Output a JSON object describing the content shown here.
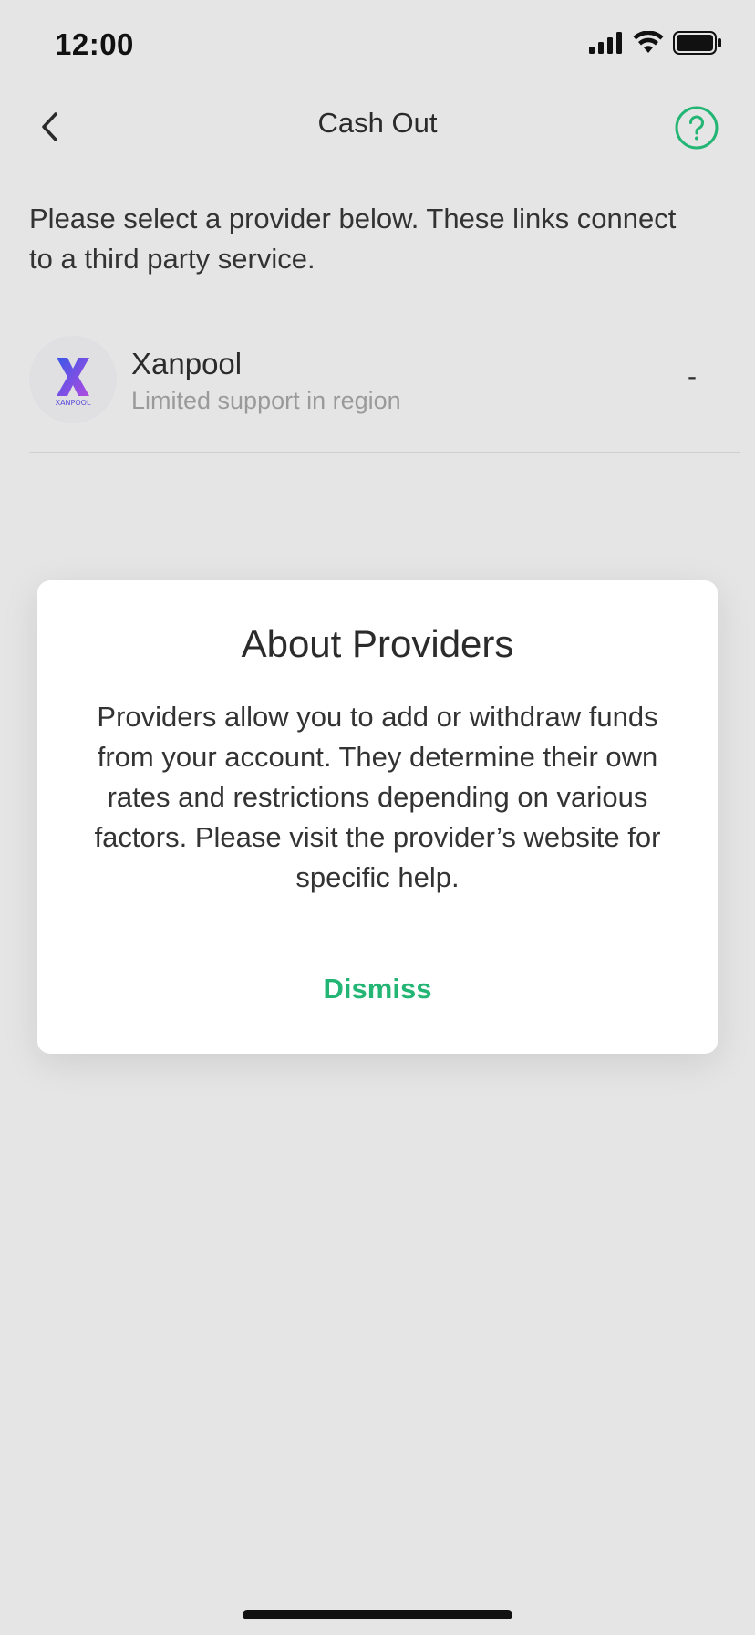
{
  "status_bar": {
    "time": "12:00"
  },
  "nav": {
    "title": "Cash Out",
    "back_icon": "chevron-left-icon",
    "help_icon": "question-circle-icon"
  },
  "intro_text": "Please select a provider below. These links connect to a third party service.",
  "providers": [
    {
      "name": "Xanpool",
      "subtitle": "Limited support in region",
      "value": "-",
      "logo_text": "XANPOOL"
    }
  ],
  "modal": {
    "title": "About Providers",
    "body": "Providers allow you to add or withdraw funds from your account. They determine their own rates and restrictions depending on various factors. Please visit the provider’s website for specific help.",
    "dismiss_label": "Dismiss"
  },
  "colors": {
    "accent": "#22b573",
    "background": "#e5e5e5"
  }
}
